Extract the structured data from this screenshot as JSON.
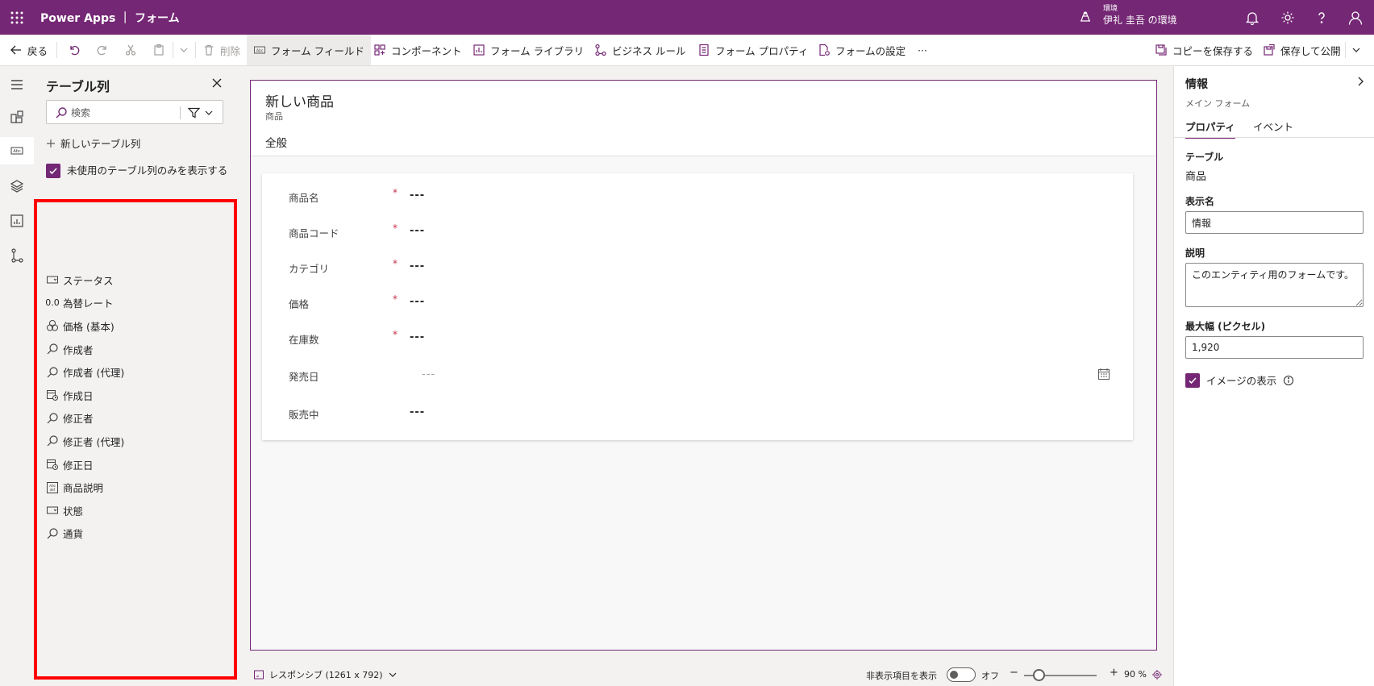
{
  "colors": {
    "brand": "#742774",
    "highlight": "#ff0000",
    "required": "#c4314b",
    "tab_underline": "#2266e3"
  },
  "app": {
    "title": "Power Apps ｜ フォーム"
  },
  "environment": {
    "label": "環境",
    "name": "伊礼 圭吾 の環境"
  },
  "topbar_icons": [
    "waffle-icon",
    "environment-icon",
    "bell-icon",
    "gear-icon",
    "help-icon",
    "user-icon"
  ],
  "commandbar": {
    "back": "戻る",
    "delete": "削除",
    "form_fields": "フォーム フィールド",
    "components": "コンポーネント",
    "form_library": "フォーム ライブラリ",
    "business_rules": "ビジネス ルール",
    "form_properties": "フォーム プロパティ",
    "form_settings": "フォームの設定",
    "more": "···",
    "save_copy": "コピーを保存する",
    "save_publish": "保存して公開"
  },
  "panel": {
    "title": "テーブル列",
    "search_placeholder": "検索",
    "new_column": "新しいテーブル列",
    "only_unused": "未使用のテーブル列のみを表示する",
    "columns": [
      {
        "label": "ステータス",
        "icon": "option-set-icon"
      },
      {
        "label": "為替レート",
        "icon": "decimal-icon"
      },
      {
        "label": "価格 (基本)",
        "icon": "currency-icon"
      },
      {
        "label": "作成者",
        "icon": "lookup-icon"
      },
      {
        "label": "作成者 (代理)",
        "icon": "lookup-icon"
      },
      {
        "label": "作成日",
        "icon": "datetime-icon"
      },
      {
        "label": "修正者",
        "icon": "lookup-icon"
      },
      {
        "label": "修正者 (代理)",
        "icon": "lookup-icon"
      },
      {
        "label": "修正日",
        "icon": "datetime-icon"
      },
      {
        "label": "商品説明",
        "icon": "multiline-text-icon"
      },
      {
        "label": "状態",
        "icon": "option-set-icon"
      },
      {
        "label": "通貨",
        "icon": "lookup-icon"
      }
    ]
  },
  "form": {
    "title": "新しい商品",
    "subtitle": "商品",
    "tab": "全般",
    "fields": [
      {
        "label": "商品名",
        "required": "*",
        "value": "---"
      },
      {
        "label": "商品コード",
        "required": "*",
        "value": "---"
      },
      {
        "label": "カテゴリ",
        "required": "*",
        "value": "---"
      },
      {
        "label": "価格",
        "required": "*",
        "value": "---"
      },
      {
        "label": "在庫数",
        "required": "*",
        "value": "---"
      },
      {
        "label": "発売日",
        "required": "",
        "value": "---"
      },
      {
        "label": "販売中",
        "required": "",
        "value": "---"
      }
    ]
  },
  "statusbar": {
    "layout": "レスポンシブ (1261 x 792)",
    "show_hidden": "非表示項目を表示",
    "toggle_state": "オフ",
    "zoom_minus": "−",
    "zoom_plus": "+",
    "zoom": "90 %",
    "zoom_fraction": 0.2
  },
  "rightpane": {
    "title": "情報",
    "subtitle": "メイン フォーム",
    "tab_properties": "プロパティ",
    "tab_events": "イベント",
    "table_label": "テーブル",
    "table_value": "商品",
    "display_name_label": "表示名",
    "display_name_value": "情報",
    "description_label": "説明",
    "description_value": "このエンティティ用のフォームです。",
    "max_width_label": "最大幅 (ピクセル)",
    "max_width_value": "1,920",
    "show_image": "イメージの表示"
  }
}
